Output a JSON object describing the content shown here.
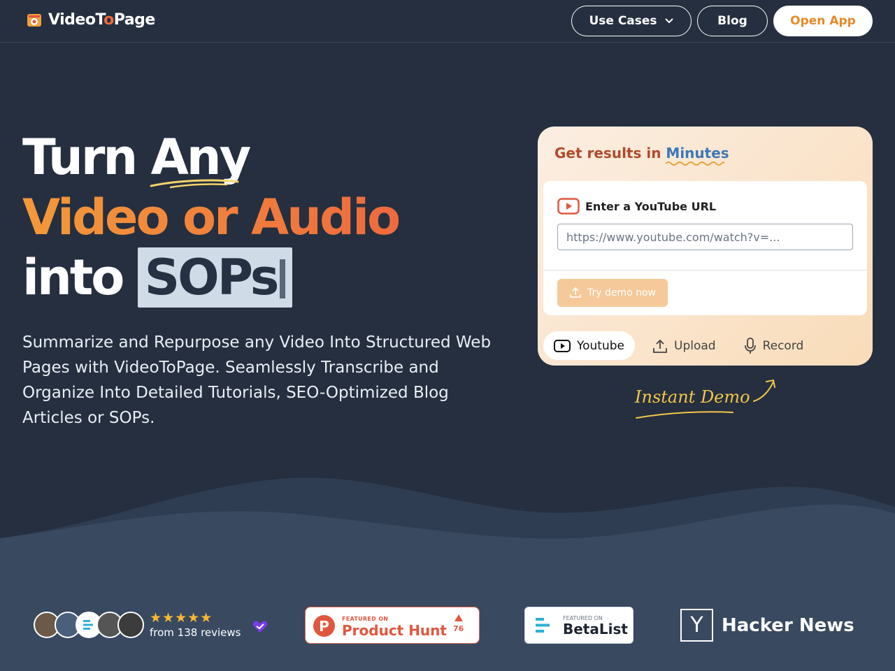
{
  "nav": {
    "logo": {
      "text_part1": "VideoT",
      "text_o": "o",
      "text_part2": "Page"
    },
    "use_cases": "Use Cases",
    "blog": "Blog",
    "open_app": "Open App"
  },
  "hero": {
    "line1_a": "Turn",
    "line1_b": "Any",
    "line2": "Video or Audio",
    "line3_a": "into",
    "line3_b": "SOPs",
    "subtitle": "Summarize and Repurpose any Video Into Structured Web Pages with VideoToPage. Seamlessly Transcribe and Organize Into Detailed Tutorials, SEO-Optimized Blog Articles or SOPs."
  },
  "card": {
    "title_a": "Get results in ",
    "title_b": "Minutes",
    "input_label": "Enter a YouTube URL",
    "input_placeholder": "https://www.youtube.com/watch?v=...",
    "demo_button": "Try demo now",
    "tabs": [
      "Youtube",
      "Upload",
      "Record"
    ]
  },
  "instant_demo": "Instant Demo",
  "social": {
    "stars": "★★★★★",
    "reviews": "from 138 reviews",
    "producthunt": {
      "small": "FEATURED ON",
      "big": "Product Hunt",
      "votes": "76"
    },
    "betalist": {
      "small": "FEATURED ON",
      "big": "BetaList"
    },
    "hackernews": {
      "letter": "Y",
      "text": "Hacker News"
    }
  },
  "colors": {
    "background": "#252f3f",
    "bottom": "#384960",
    "accent_orange": "#ee6a3e",
    "open_app_text": "#e58a2a"
  }
}
